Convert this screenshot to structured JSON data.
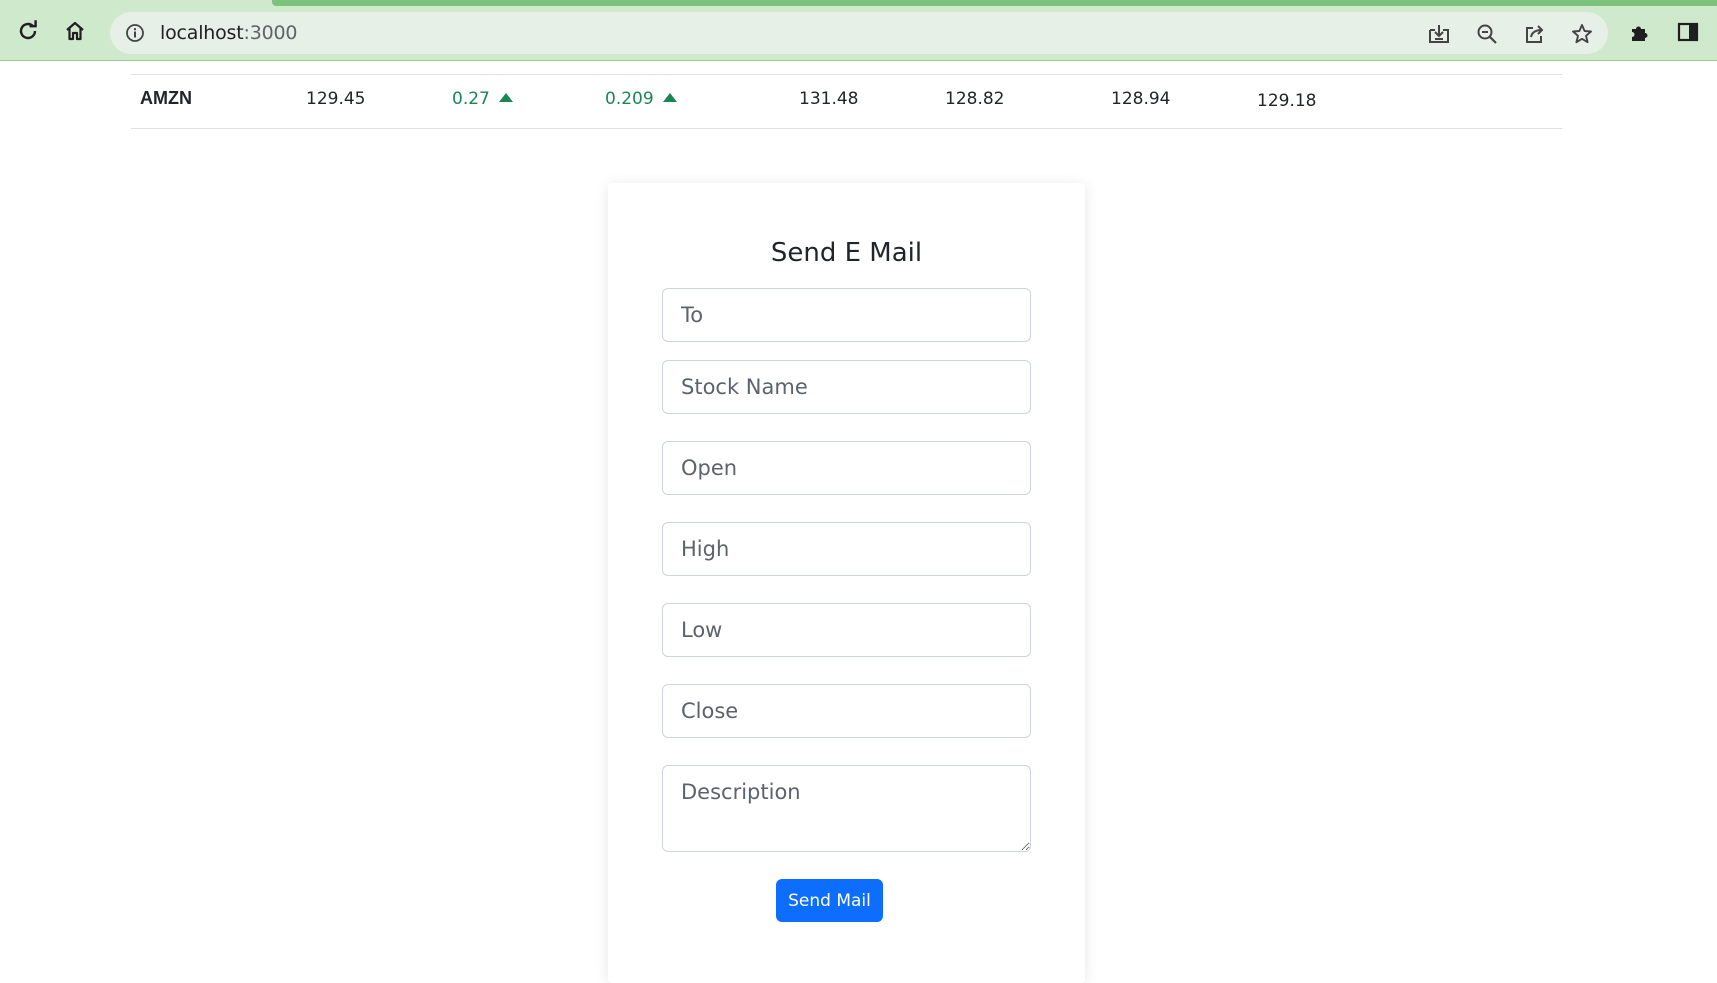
{
  "browser": {
    "url_host": "localhost",
    "url_port": ":3000",
    "icons": [
      "reload-icon",
      "home-icon",
      "site-info-icon",
      "install-icon",
      "zoom-out-icon",
      "share-icon",
      "bookmark-star-icon",
      "extensions-icon",
      "side-panel-icon"
    ]
  },
  "stock_row": {
    "symbol": "AMZN",
    "price": "129.45",
    "change": "0.27",
    "change_pct": "0.209",
    "open": "131.48",
    "low": "128.82",
    "prev": "128.94",
    "close": "129.18"
  },
  "form": {
    "title": "Send E Mail",
    "to_placeholder": "To",
    "stock_name_placeholder": "Stock Name",
    "open_placeholder": "Open",
    "high_placeholder": "High",
    "low_placeholder": "Low",
    "close_placeholder": "Close",
    "description_placeholder": "Description",
    "submit_label": "Send Mail"
  },
  "colors": {
    "up": "#198754",
    "primary": "#0d6efd",
    "chrome_bg": "#cfe9cc"
  }
}
